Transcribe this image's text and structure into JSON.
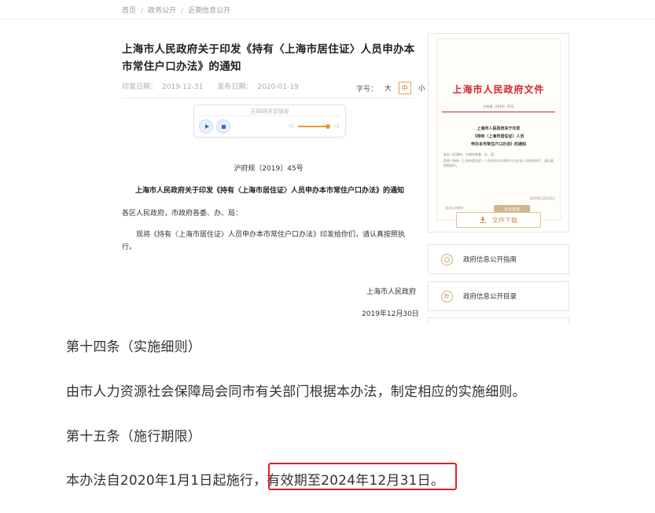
{
  "breadcrumb": {
    "items": [
      "首页",
      "政务公开",
      "近期信息公开"
    ],
    "separator": "/"
  },
  "article": {
    "title": "上海市人民政府关于印发《持有〈上海市居住证〉人员申办本市常住户口办法》的通知",
    "print_date_label": "印发日期：",
    "print_date": "2019-12-31",
    "publish_date_label": "发布日期：",
    "publish_date": "2020-01-19",
    "font_size_label": "字号：",
    "font_sizes": [
      "大",
      "中",
      "小"
    ],
    "font_size_active": "中"
  },
  "player": {
    "label": "无障碍语音播报",
    "volume_level": 0.95
  },
  "doc": {
    "number": "沪府规〔2019〕45号",
    "subtitle": "上海市人民政府关于印发《持有〈上海市居住证〉人员申办本市常住户口办法》的通知",
    "recipients": "各区人民政府，市政府各委、办、局：",
    "paragraph": "现将《持有〈上海市居住证〉人员申办本市常住户口办法》印发给你们，请认真按照执行。",
    "signature": "上海市人民政府",
    "date": "2019年12月30日"
  },
  "sidebar": {
    "cover": {
      "header": "上海市人民政府文件",
      "number": "沪府规〔2019〕45号",
      "title_lines": [
        "上海市人民政府关于印发",
        "《持有〈上海市居住证〉人员",
        "申办本市常住户口办法》的通知"
      ],
      "recipients": "各区人民政府，市政府各委、办、局：",
      "body": "现将《持有〈上海市居住证〉人员申办本市常住户口办法》印发给你们，请认真按照执行。",
      "date": "2019年12月30日",
      "bottom_note": "（此件公开发布）",
      "stamp_label": "点击查看",
      "download_label": "文件下载"
    },
    "links": [
      {
        "label": "政府信息公开指南",
        "icon": "guide-icon"
      },
      {
        "label": "政府信息公开目录",
        "icon": "catalog-icon"
      }
    ]
  },
  "zoom": {
    "article14_title": "第十四条（实施细则）",
    "article14_body": "由市人力资源社会保障局会同市有关部门根据本办法，制定相应的实施细则。",
    "article15_title": "第十五条（施行期限）",
    "article15_body_start": "本办法自2020年1月1日起施行，",
    "article15_body_highlight": "有效期至2024年12月31日。"
  },
  "colors": {
    "accent_gold": "#c79a50",
    "red": "#d3242b",
    "highlight_border": "#e0201f"
  }
}
